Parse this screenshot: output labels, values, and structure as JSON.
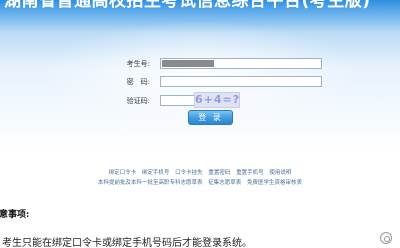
{
  "banner": {
    "title": "湖南省普通高校招生考试信息综合平台(考生版)"
  },
  "login_form": {
    "username_label": "考生号:",
    "password_label": "密　码:",
    "captcha_label": "验证码:",
    "captcha_text": "6+4=?",
    "login_button": "登 录"
  },
  "links_row1": [
    "绑定口令卡",
    "绑定手机号",
    "口令卡挂失",
    "重置密码",
    "重置手机号",
    "使用说明"
  ],
  "links_row2": [
    "本科提前批及本科一批至高职专科志愿草表",
    "征集志愿草表",
    "免费医学生资格审核表"
  ],
  "notice": {
    "title": "意事项:",
    "line1": "考生只能在绑定口令卡或绑定手机号码后才能登录系统。"
  },
  "colors": {
    "accent": "#2f8fe0",
    "link": "#4a6e98",
    "button": "#3e9be0"
  }
}
